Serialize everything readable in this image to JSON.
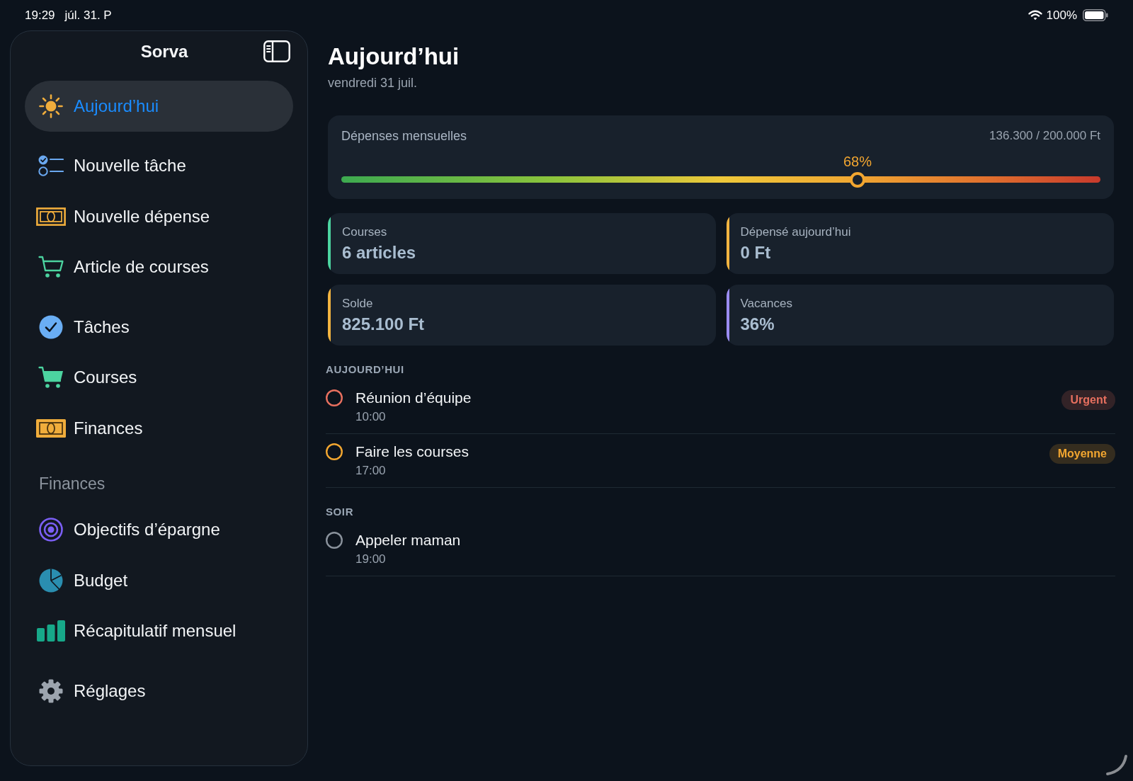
{
  "status_bar": {
    "time": "19:29",
    "date": "júl. 31. P",
    "battery": "100%"
  },
  "sidebar": {
    "title": "Sorva",
    "groups": [
      {
        "items": [
          {
            "label": "Aujourd’hui",
            "selected": true
          }
        ]
      },
      {
        "items": [
          {
            "label": "Nouvelle tâche",
            "selected": false
          },
          {
            "label": "Nouvelle dépense",
            "selected": false
          },
          {
            "label": "Article de courses",
            "selected": false
          }
        ]
      },
      {
        "items": [
          {
            "label": "Tâches",
            "selected": false
          },
          {
            "label": "Courses",
            "selected": false
          },
          {
            "label": "Finances",
            "selected": false
          }
        ]
      },
      {
        "header": "Finances",
        "items": [
          {
            "label": "Objectifs d’épargne",
            "selected": false
          },
          {
            "label": "Budget",
            "selected": false
          },
          {
            "label": "Récapitulatif mensuel",
            "selected": false
          }
        ]
      },
      {
        "items": [
          {
            "label": "Réglages",
            "selected": false
          }
        ]
      }
    ]
  },
  "header": {
    "title": "Aujourd’hui",
    "subtitle": "vendredi 31 juil."
  },
  "budget": {
    "label": "Dépenses mensuelles",
    "amount": "136.300 / 200.000 Ft",
    "percent": "68%",
    "level": 0.68
  },
  "stats": [
    {
      "label": "Courses",
      "value": "6 articles",
      "color": "#4cd4a0"
    },
    {
      "label": "Dépensé aujourd’hui",
      "value": "0 Ft",
      "color": "#f2b440"
    },
    {
      "label": "Solde",
      "value": "825.100 Ft",
      "color": "#f2b440"
    },
    {
      "label": "Vacances",
      "value": "36%",
      "color": "#9b8cf2"
    }
  ],
  "sections": [
    {
      "title": "AUJOURD’HUI",
      "tasks": [
        {
          "title": "Réunion d’équipe",
          "time": "10:00",
          "color": "#e8705f",
          "checked": false,
          "badge": "Urgent"
        },
        {
          "title": "Faire les courses",
          "time": "17:00",
          "color": "#f2a630",
          "checked": false,
          "badge": "Moyenne"
        }
      ]
    },
    {
      "title": "SOIR",
      "tasks": [
        {
          "title": "Appeler maman",
          "time": "19:00",
          "color": "#8a929c",
          "checked": false
        }
      ]
    }
  ]
}
